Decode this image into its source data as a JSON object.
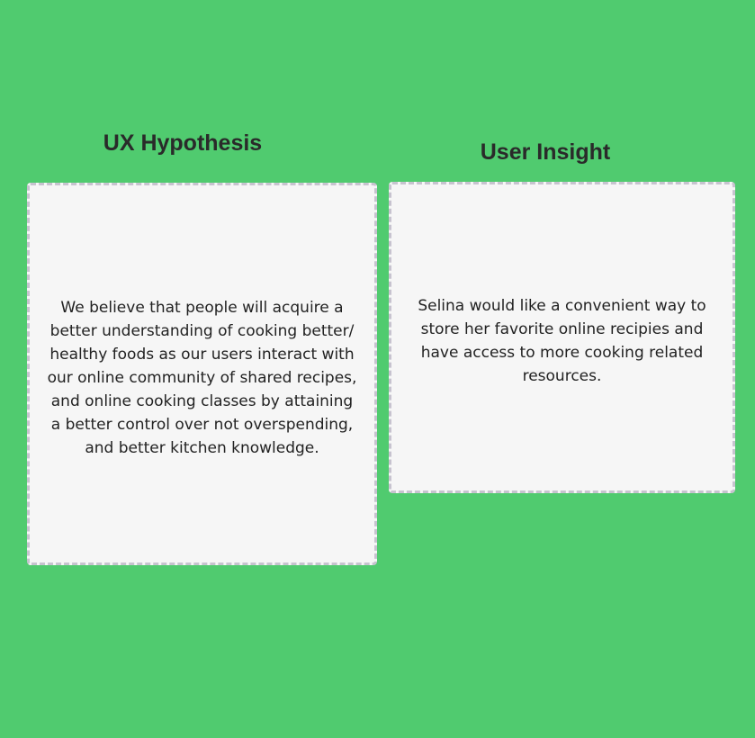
{
  "theme": {
    "background": "#50cb6f",
    "card_background": "#f6f6f6",
    "card_border": "#c7c3cf",
    "text_color": "#222222"
  },
  "sections": [
    {
      "title": "UX Hypothesis",
      "body": "We believe that people will acquire a better understanding of cooking better/ healthy foods as our users interact with our online community of shared recipes, and online cooking classes by attaining a better control over not overspending, and better kitchen knowledge."
    },
    {
      "title": "User Insight",
      "body": "Selina would like a convenient way to store her favorite online recipies and have access to more cooking related resources."
    }
  ]
}
